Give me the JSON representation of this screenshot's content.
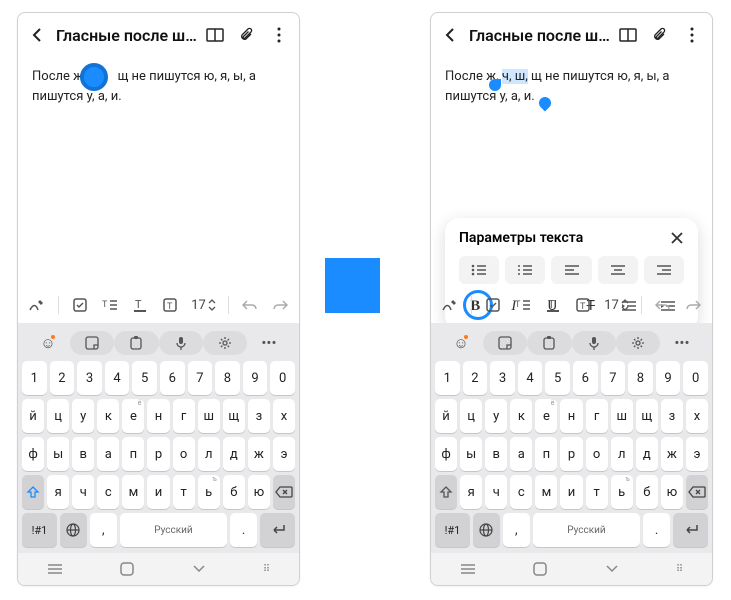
{
  "header": {
    "title": "Гласные после шип…"
  },
  "note_left": {
    "line1_pre": "После ж",
    "line1_post": "щ не пишутся ю, я, ы, а",
    "line2": "пишутся у, а, и."
  },
  "note_right": {
    "line1_a": "После ж, ",
    "line1_sel": "ч, ш,",
    "line1_b": " щ не пишутся ю, я, ы, а",
    "line2": "пишутся у, а, и."
  },
  "popup": {
    "title": "Параметры текста",
    "bold": "B",
    "italic": "I",
    "underline": "U",
    "strike": "T"
  },
  "toolbar": {
    "fontsize": "17"
  },
  "keyboard": {
    "numrow": [
      "1",
      "2",
      "3",
      "4",
      "5",
      "6",
      "7",
      "8",
      "9",
      "0"
    ],
    "row1": [
      "й",
      "ц",
      "у",
      "к",
      "е",
      "н",
      "г",
      "ш",
      "щ",
      "з",
      "х"
    ],
    "row1sup": [
      "",
      "",
      "",
      "",
      "ё",
      "",
      "",
      "",
      "",
      "",
      ""
    ],
    "row2": [
      "ф",
      "ы",
      "в",
      "а",
      "п",
      "р",
      "о",
      "л",
      "д",
      "ж",
      "э"
    ],
    "row3": [
      "я",
      "ч",
      "с",
      "м",
      "и",
      "т",
      "ь",
      "б",
      "ю"
    ],
    "row3sup": [
      "",
      "",
      "",
      "",
      "",
      "",
      "ъ",
      "",
      ""
    ],
    "symkey": "!#1",
    "comma": ",",
    "space": "Русский",
    "period": "."
  },
  "colors": {
    "accent": "#1a8cff"
  }
}
